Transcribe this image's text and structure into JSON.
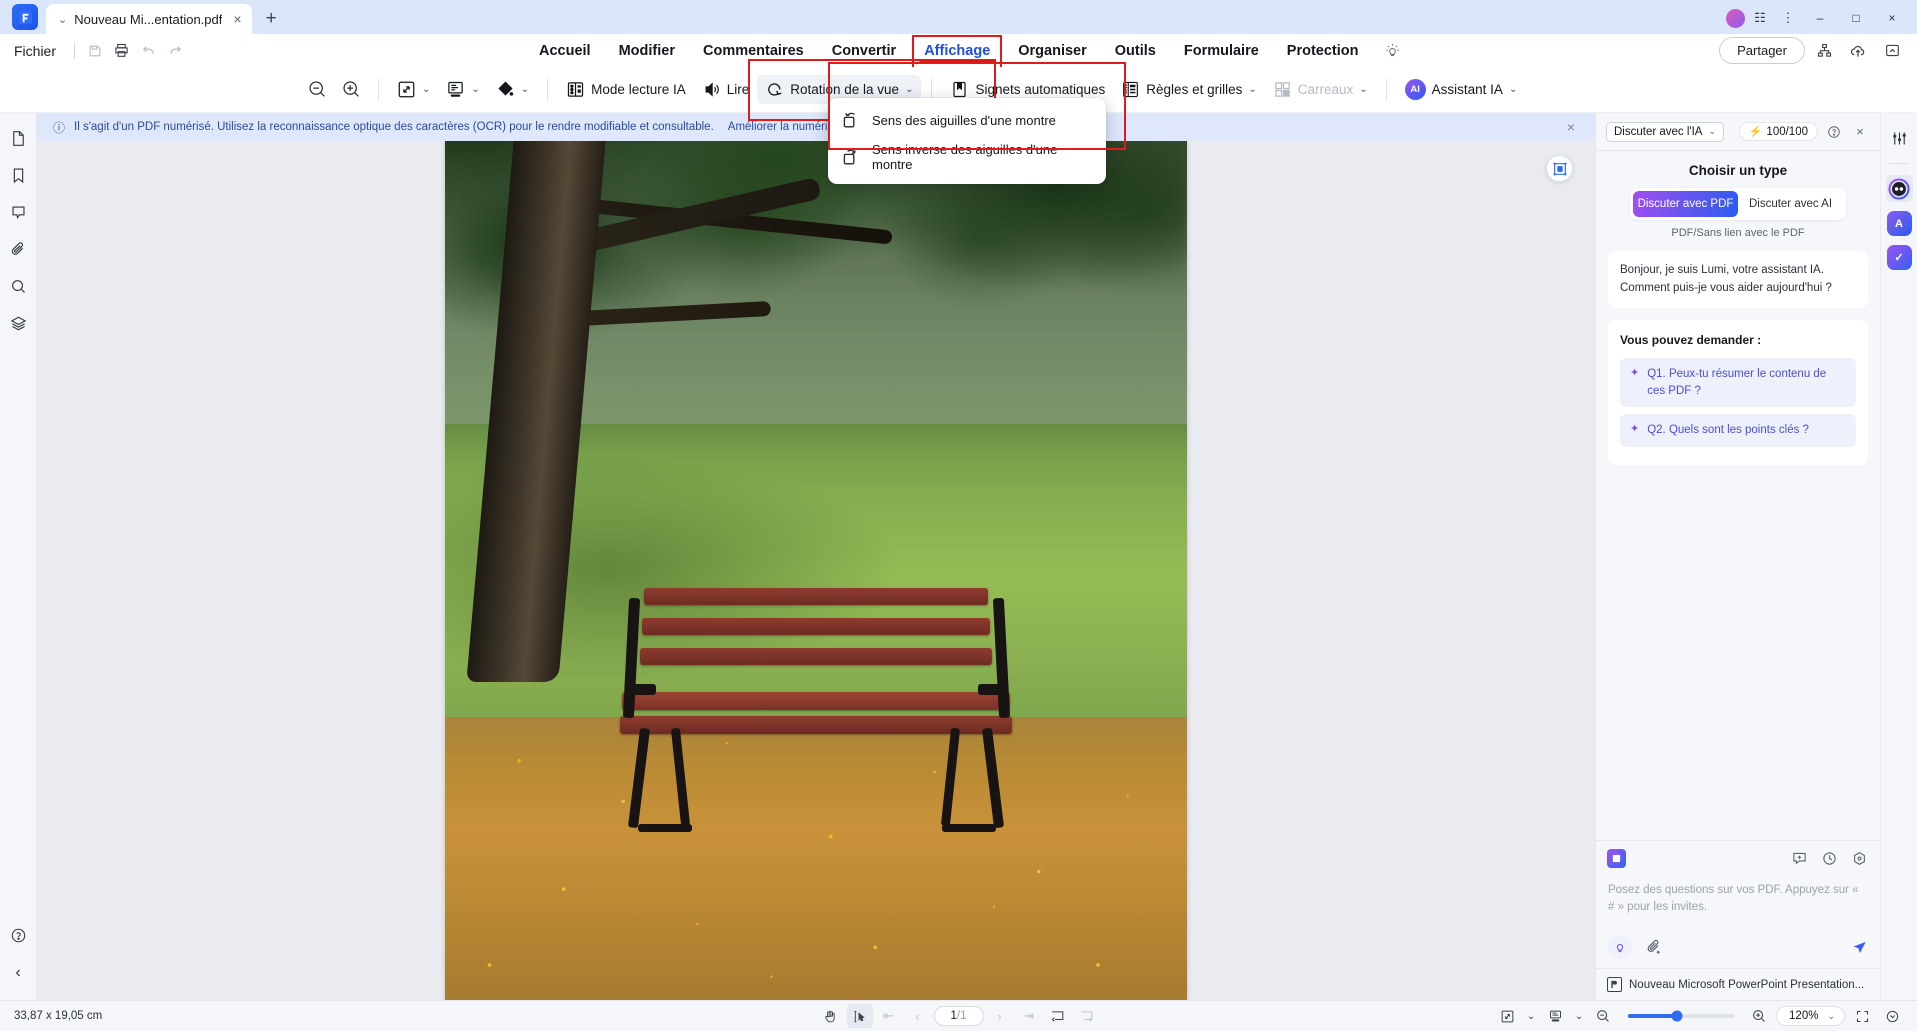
{
  "titlebar": {
    "tab_title": "Nouveau Mi...entation.pdf",
    "tab_close": "×",
    "new_tab": "+",
    "minimize": "–",
    "maximize": "□",
    "close": "×"
  },
  "menubar": {
    "file": "Fichier",
    "tabs": [
      {
        "label": "Accueil",
        "active": false
      },
      {
        "label": "Modifier",
        "active": false
      },
      {
        "label": "Commentaires",
        "active": false
      },
      {
        "label": "Convertir",
        "active": false
      },
      {
        "label": "Affichage",
        "active": true
      },
      {
        "label": "Organiser",
        "active": false
      },
      {
        "label": "Outils",
        "active": false
      },
      {
        "label": "Formulaire",
        "active": false
      },
      {
        "label": "Protection",
        "active": false
      }
    ],
    "share": "Partager"
  },
  "ribbon": {
    "zoom_out": "zoom-out-icon",
    "zoom_in": "zoom-in-icon",
    "fit": "fit-page-icon",
    "layout": "page-layout-icon",
    "background": "background-fill-icon",
    "read_mode": "Mode lecture IA",
    "read_aloud": "Lire",
    "rotation": "Rotation de la vue",
    "bookmarks": "Signets automatiques",
    "rules": "Règles et grilles",
    "tiles": "Carreaux",
    "ai_assistant": "Assistant IA",
    "ai_badge": "AI"
  },
  "dropdown": {
    "items": [
      {
        "label": "Sens des aiguilles d'une montre",
        "icon": "rotate-clockwise-icon"
      },
      {
        "label": "Sens inverse des aiguilles d'une montre",
        "icon": "rotate-counterclockwise-icon"
      }
    ]
  },
  "banner": {
    "text": "Il s'agit d'un PDF numérisé. Utilisez la reconnaissance optique des caractères (OCR) pour le rendre modifiable et consultable.",
    "action": "Améliorer la numérisation",
    "close": "×"
  },
  "left_rail": {
    "items": [
      {
        "name": "pages-panel",
        "icon": "page-icon"
      },
      {
        "name": "bookmarks-panel",
        "icon": "bookmark-icon"
      },
      {
        "name": "comments-panel",
        "icon": "comment-icon"
      },
      {
        "name": "attachments-panel",
        "icon": "paperclip-icon"
      },
      {
        "name": "search-panel",
        "icon": "search-icon"
      },
      {
        "name": "layers-panel",
        "icon": "layers-icon"
      }
    ],
    "help": "?",
    "collapse": "‹"
  },
  "ai_panel": {
    "mode_select": "Discuter avec l'IA",
    "credits": "100/100",
    "help": "?",
    "close": "×",
    "choose_title": "Choisir un type",
    "seg_pdf": "Discuter avec PDF",
    "seg_ai": "Discuter avec AI",
    "seg_sub": "PDF/Sans lien avec le PDF",
    "greeting": "Bonjour, je suis Lumi, votre assistant IA. Comment puis-je vous aider aujourd'hui ?",
    "ask_header": "Vous pouvez demander :",
    "suggestions": [
      "Q1. Peux-tu résumer le contenu de ces PDF ?",
      "Q2. Quels sont les points clés ?"
    ],
    "input_placeholder": "Posez des questions sur vos PDF. Appuyez sur « # » pour les invites.",
    "attached_file": "Nouveau Microsoft PowerPoint Presentation..."
  },
  "right_rail": {
    "items": [
      {
        "name": "settings-sliders-icon"
      },
      {
        "name": "lumi-bot-icon"
      },
      {
        "name": "ai-translate-icon"
      },
      {
        "name": "ai-check-icon"
      }
    ]
  },
  "statusbar": {
    "dimensions": "33,87 x 19,05 cm",
    "page_current": "1",
    "page_total": "/1",
    "zoom_level": "120%"
  }
}
